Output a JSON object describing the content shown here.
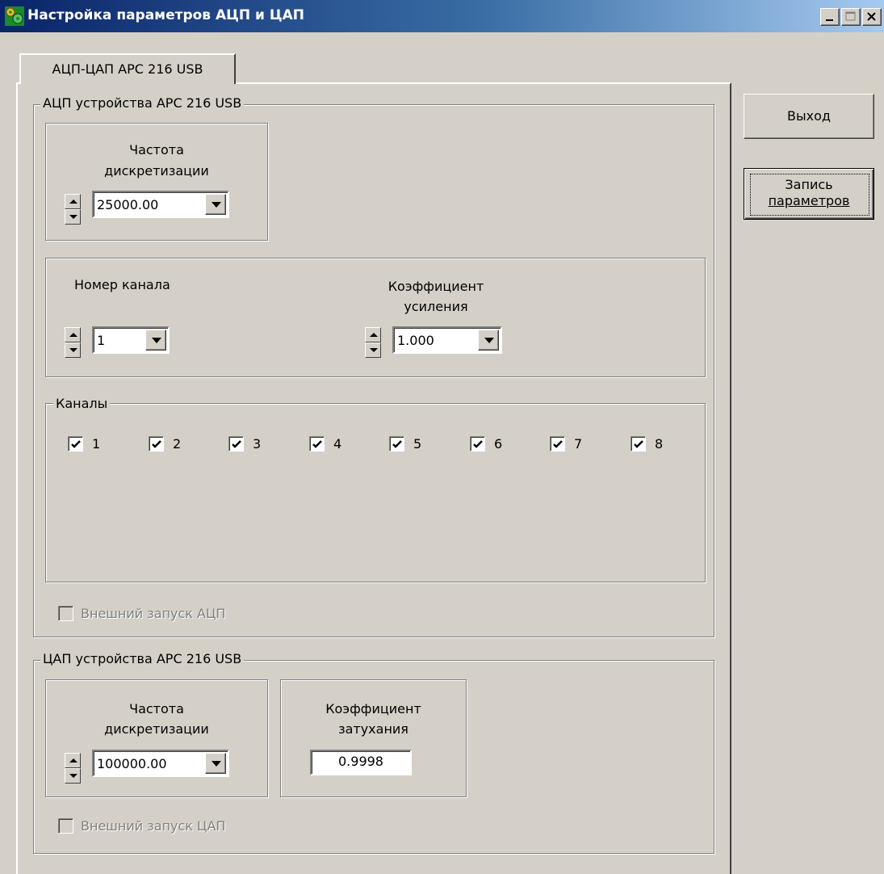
{
  "window": {
    "title": "Настройка параметров АЦП и ЦАП",
    "buttons": [
      "minimize",
      "maximize",
      "close"
    ]
  },
  "tab": {
    "label": "АЦП-ЦАП APC 216 USB"
  },
  "adc": {
    "group_label": "АЦП устройства APC 216 USB",
    "sample_rate_label_line1": "Частота",
    "sample_rate_label_line2": "дискретизации",
    "sample_rate_value": "25000.00",
    "channel_number_label": "Номер канала",
    "channel_number_value": "1",
    "gain_label_line1": "Коэффициент",
    "gain_label_line2": "усиления",
    "gain_value": "1.000",
    "channels_label": "Каналы",
    "channels": [
      {
        "label": "1",
        "checked": true
      },
      {
        "label": "2",
        "checked": true
      },
      {
        "label": "3",
        "checked": true
      },
      {
        "label": "4",
        "checked": true
      },
      {
        "label": "5",
        "checked": true
      },
      {
        "label": "6",
        "checked": true
      },
      {
        "label": "7",
        "checked": true
      },
      {
        "label": "8",
        "checked": true
      }
    ],
    "external_trigger_label": "Внешний запуск АЦП",
    "external_trigger_checked": false
  },
  "dac": {
    "group_label": "ЦАП устройства APC 216 USB",
    "sample_rate_label_line1": "Частота",
    "sample_rate_label_line2": "дискретизации",
    "sample_rate_value": "100000.00",
    "attenuation_label_line1": "Коэффициент",
    "attenuation_label_line2": "затухания",
    "attenuation_value": "0.9998",
    "external_trigger_label": "Внешний запуск ЦАП",
    "external_trigger_checked": false
  },
  "actions": {
    "exit_label": "Выход",
    "save_label_line1": "Запись",
    "save_label_line2": "параметров"
  },
  "icons": {
    "app": "app-gears-icon",
    "minimize": "minimize-icon",
    "maximize": "maximize-icon",
    "close": "close-icon",
    "spin_up": "spin-up-arrow-icon",
    "spin_down": "spin-down-arrow-icon",
    "dropdown": "dropdown-arrow-icon",
    "check": "checkmark-icon"
  }
}
